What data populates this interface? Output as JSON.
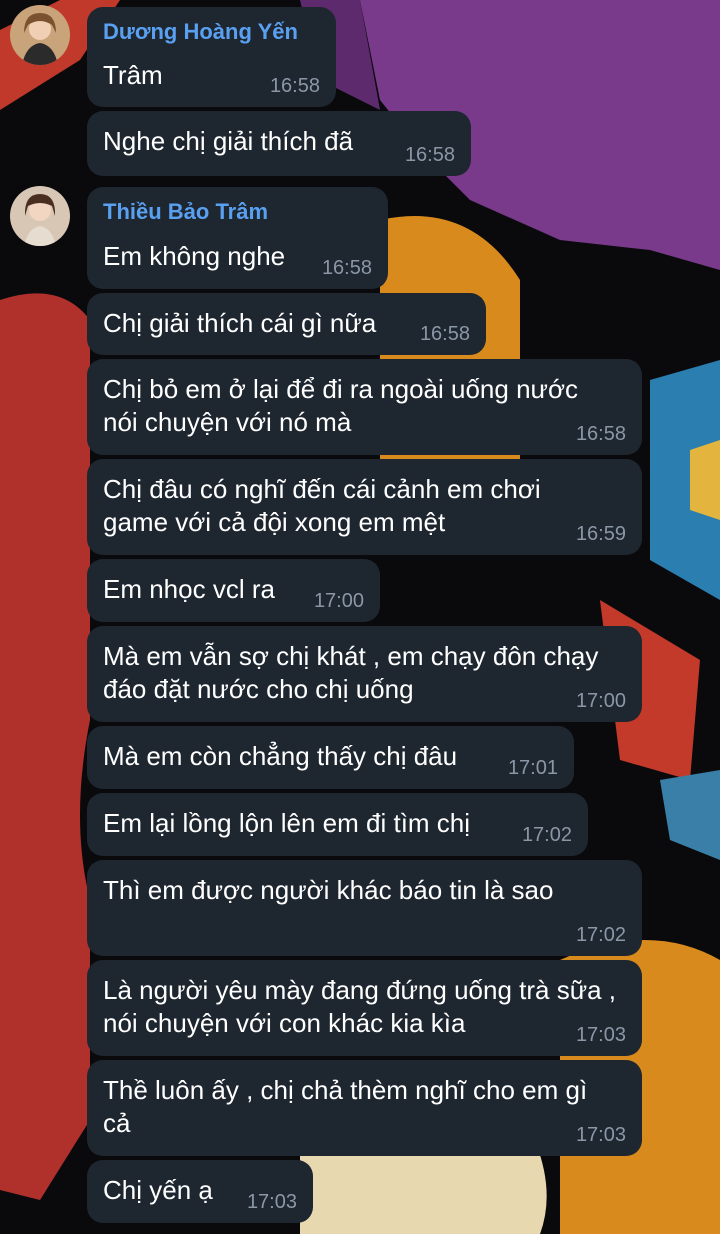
{
  "messages": [
    {
      "sender": "Dương Hoàng Yến",
      "text": "Trâm",
      "time": "16:58"
    },
    {
      "text": "Nghe chị giải thích đã",
      "time": "16:58"
    },
    {
      "sender": "Thiều Bảo Trâm",
      "text": "Em không nghe",
      "time": "16:58"
    },
    {
      "text": "Chị giải thích cái gì nữa",
      "time": "16:58"
    },
    {
      "text": "Chị bỏ em ở lại để đi ra ngoài uống nước\nnói chuyện với nó mà",
      "time": "16:58"
    },
    {
      "text": "Chị đâu có nghĩ đến cái cảnh em chơi\ngame với cả đội xong em mệt",
      "time": "16:59"
    },
    {
      "text": "Em nhọc vcl ra",
      "time": "17:00"
    },
    {
      "text": "Mà em vẫn sợ chị khát , em chạy đôn chạy\nđáo đặt nước cho chị uống",
      "time": "17:00"
    },
    {
      "text": "Mà em còn chẳng thấy chị đâu",
      "time": "17:01"
    },
    {
      "text": "Em lại lồng lộn lên em đi tìm chị",
      "time": "17:02"
    },
    {
      "text": "Thì em được người khác báo tin là sao",
      "time": "17:02"
    },
    {
      "text": "Là người yêu mày đang đứng uống trà sữa ,\nnói chuyện với con khác kia kìa",
      "time": "17:03"
    },
    {
      "text": "Thề luôn ấy , chị chả thèm nghĩ cho em gì\ncả",
      "time": "17:03"
    },
    {
      "text": "Chị yến ạ",
      "time": "17:03"
    }
  ],
  "colors": {
    "bubble": "#1e2630",
    "sender_name": "#5aa0f0",
    "time": "#8a97a6",
    "background": "#0a0a0c"
  }
}
